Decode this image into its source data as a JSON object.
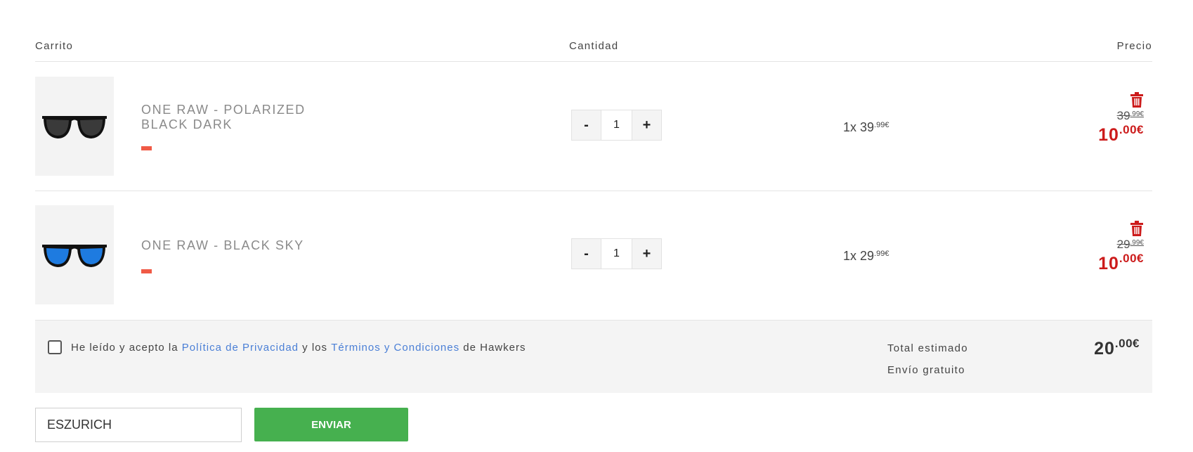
{
  "header": {
    "cart_label": "Carrito",
    "quantity_label": "Cantidad",
    "price_label": "Precio"
  },
  "items": [
    {
      "name_line1": "ONE RAW - POLARIZED",
      "name_line2": "BLACK DARK",
      "lens_color": "#3a3a3a",
      "swatch_color": "#f05a46",
      "quantity": "1",
      "minus_label": "-",
      "plus_label": "+",
      "unit_prefix": "1x 39",
      "unit_cents": ".99€",
      "old_int": "39",
      "old_cents": ".99€",
      "new_int": "10",
      "new_cents": ".00€"
    },
    {
      "name_line1": "ONE RAW - BLACK SKY",
      "name_line2": "",
      "lens_color": "#1e7be0",
      "swatch_color": "#f05a46",
      "quantity": "1",
      "minus_label": "-",
      "plus_label": "+",
      "unit_prefix": "1x 29",
      "unit_cents": ".99€",
      "old_int": "29",
      "old_cents": ".99€",
      "new_int": "10",
      "new_cents": ".00€"
    }
  ],
  "terms": {
    "part1": "He leído y acepto la ",
    "privacy_link": "Política de Privacidad",
    "part2": " y los ",
    "terms_link": "Términos y Condiciones",
    "part3": " de Hawkers"
  },
  "summary": {
    "total_label": "Total estimado",
    "shipping_label": "Envío gratuito",
    "total_int": "20",
    "total_cents": ".00€"
  },
  "coupon": {
    "value": "ESZURICH",
    "button_label": "ENVIAR"
  },
  "colors": {
    "accent_red": "#cc1b1b",
    "link_blue": "#4a7fd6",
    "button_green": "#46b04f"
  }
}
